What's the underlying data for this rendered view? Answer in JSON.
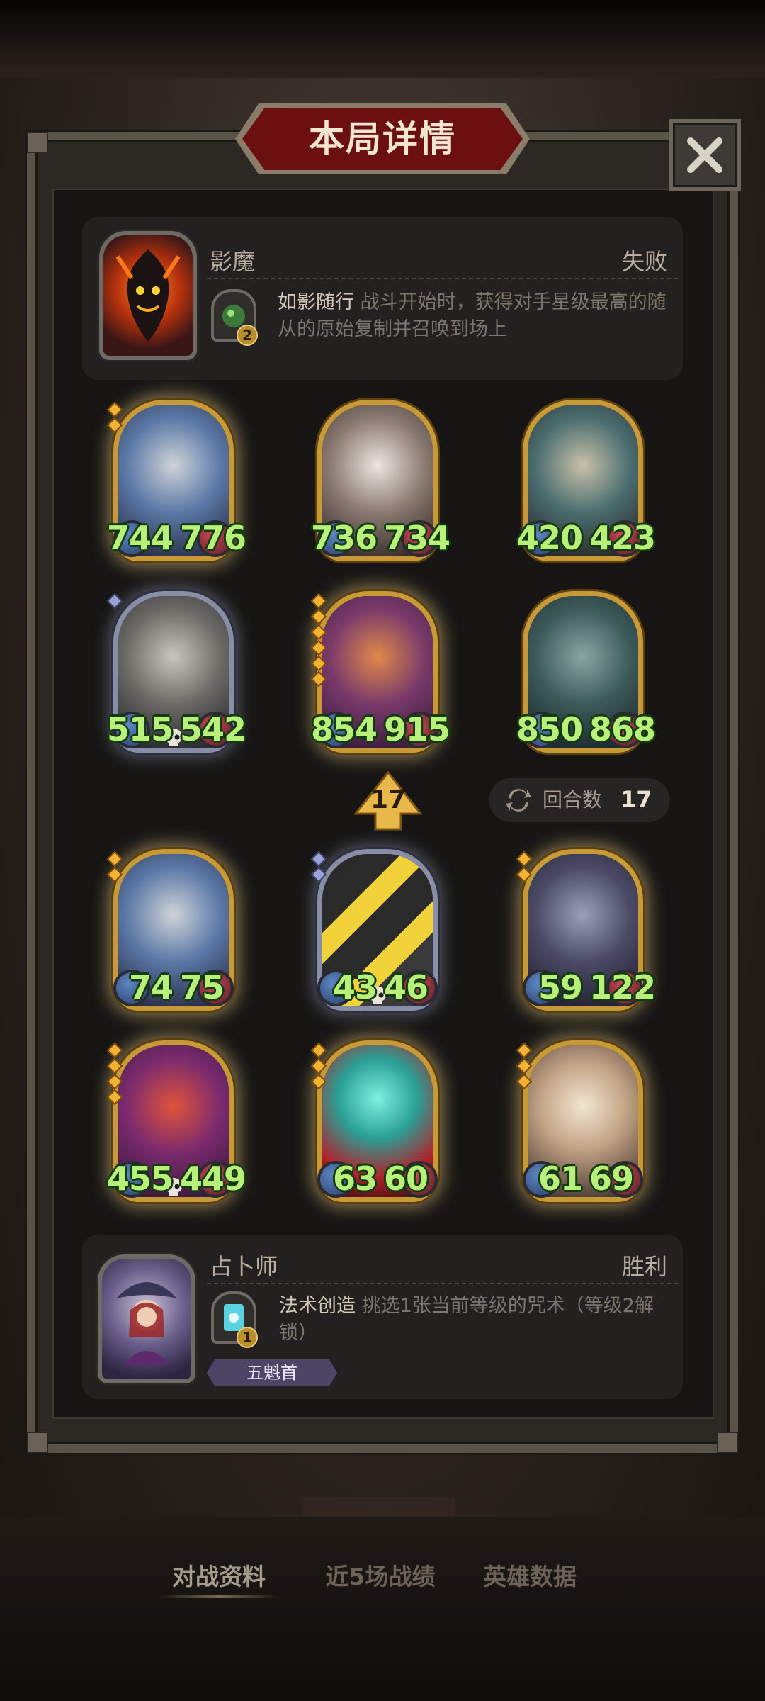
{
  "dialog": {
    "title": "本局详情",
    "close_label": "✕"
  },
  "opponent": {
    "name": "影魔",
    "result": "失败",
    "skill_name": "如影随行",
    "skill_desc": " 战斗开始时，获得对手星级最高的随从的原始复制并召唤到场上",
    "skill_level": "2"
  },
  "opponent_board": [
    {
      "attack": "744",
      "health": "776",
      "stars": 2,
      "tier": "gold",
      "art": "paladin-knight"
    },
    {
      "attack": "736",
      "health": "734",
      "stars": 0,
      "tier": "gold",
      "art": "masked-rabbit"
    },
    {
      "attack": "420",
      "health": "423",
      "stars": 0,
      "tier": "gold",
      "art": "fanged-beast"
    },
    {
      "attack": "515",
      "health": "542",
      "stars": 1,
      "tier": "silver",
      "art": "bone-dragon",
      "dead": true
    },
    {
      "attack": "854",
      "health": "915",
      "stars": 6,
      "tier": "gold",
      "art": "red-dragon"
    },
    {
      "attack": "850",
      "health": "868",
      "stars": 0,
      "tier": "gold",
      "art": "iron-golem"
    }
  ],
  "round": {
    "arrow_number": "17",
    "label": "回合数",
    "value": "17"
  },
  "player_board": [
    {
      "attack": "74",
      "health": "75",
      "stars": 2,
      "tier": "gold",
      "art": "paladin-knight"
    },
    {
      "attack": "43",
      "health": "46",
      "stars": 2,
      "tier": "silver",
      "art": "thunder-cannon",
      "dead": true
    },
    {
      "attack": "59",
      "health": "122",
      "stars": 2,
      "tier": "gold",
      "art": "shadow-gargoyle"
    },
    {
      "attack": "455",
      "health": "449",
      "stars": 4,
      "tier": "gold",
      "art": "winged-demon",
      "dead": true
    },
    {
      "attack": "63",
      "health": "60",
      "stars": 3,
      "tier": "gold",
      "art": "spirit-caster"
    },
    {
      "attack": "61",
      "health": "69",
      "stars": 3,
      "tier": "gold",
      "art": "old-professor"
    }
  ],
  "player": {
    "name": "占卜师",
    "result": "胜利",
    "skill_name": "法术创造",
    "skill_desc": " 挑选1张当前等级的咒术（等级2解锁）",
    "skill_level": "1",
    "rank_badge": "五魁首"
  },
  "bottom_tabs": {
    "tab1": "对战资料",
    "tab2": "近5场战绩",
    "tab3": "英雄数据"
  },
  "colors": {
    "stat_green": "#b9f07a",
    "gold_frame": "#c89a37",
    "title_red": "#6b0f10"
  }
}
